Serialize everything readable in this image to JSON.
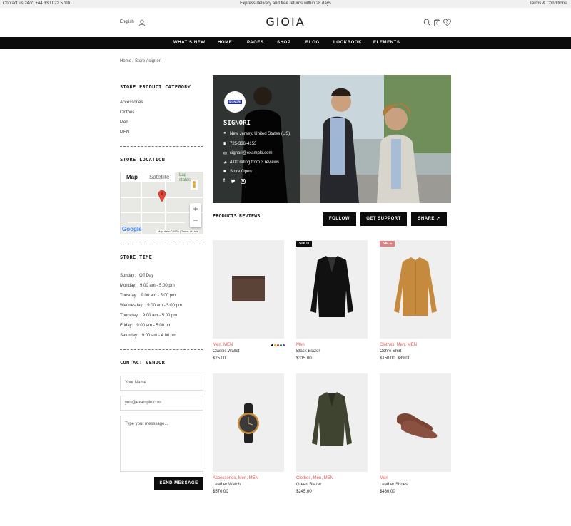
{
  "topbar": {
    "contact": "Contact us 24/7: +44 330 022 5700",
    "promo": "Express delivery and free returns within 28 days",
    "terms": "Terms & Conditions"
  },
  "header": {
    "language": "English",
    "logo": "GIOIA",
    "cart_count": "0",
    "wishlist_count": "0"
  },
  "nav": [
    "WHAT'S NEW",
    "HOME",
    "PAGES",
    "SHOP",
    "BLOG",
    "LOOKBOOK",
    "ELEMENTS"
  ],
  "breadcrumb": "Home / Store / signori",
  "sidebar": {
    "category_title": "STORE PRODUCT CATEGORY",
    "categories": [
      "Accessories",
      "Clothes",
      "Men",
      "MEN"
    ],
    "location_title": "STORE LOCATION",
    "map": {
      "tab_map": "Map",
      "tab_satellite": "Satellite",
      "label_lag": "Lag",
      "label_states": "states",
      "zoom_in": "+",
      "zoom_out": "−",
      "google": "Google",
      "map_data": "Map data ©2020",
      "terms": "Terms of Use"
    },
    "time_title": "STORE TIME",
    "hours": [
      {
        "day": "Sunday:",
        "time": "Off Day"
      },
      {
        "day": "Monday:",
        "time": "9:00 am - 5:00 pm"
      },
      {
        "day": "Tuesday:",
        "time": "9:00 am - 5:00 pm"
      },
      {
        "day": "Wednesday:",
        "time": "9:00 am - 5:00 pm"
      },
      {
        "day": "Thursday:",
        "time": "9:00 am - 5:00 pm"
      },
      {
        "day": "Friday:",
        "time": "9:00 am - 5:00 pm"
      },
      {
        "day": "Saturday:",
        "time": "9:00 am - 4:00 pm"
      }
    ],
    "contact_title": "CONTACT VENDOR",
    "name_placeholder": "Your Name",
    "email_placeholder": "you@example.com",
    "message_placeholder": "Type your messsage...",
    "send_label": "SEND MESSAGE"
  },
  "store": {
    "logo_text": "SIGNORI",
    "name": "SIGNORI",
    "address": "New Jersey, United States (US)",
    "phone": "725-336-4153",
    "email": "signori@example.com",
    "rating": "4.00 rating from 3 reviews",
    "status": "Store Open"
  },
  "tabs": {
    "products": "PRODUCTS",
    "reviews": "REVIEWS"
  },
  "actions": {
    "follow": "FOLLOW",
    "support": "GET SUPPORT",
    "share": "SHARE"
  },
  "products": [
    {
      "category": "Men, MEN",
      "name": "Classic Wallet",
      "price": "$25.00",
      "old_price": "",
      "badge": "",
      "swatches": [
        "#111111",
        "#e0b020",
        "#c23a3a",
        "#2a8a3a",
        "#6a3ab0"
      ]
    },
    {
      "category": "Men",
      "name": "Black Blazer",
      "price": "$315.00",
      "old_price": "",
      "badge": "SOLD"
    },
    {
      "category": "Clothes, Men, MEN",
      "name": "Ochre Shirt",
      "price": "$89.00",
      "old_price": "$150.00",
      "badge": "SALE"
    },
    {
      "category": "Accessories, Men, MEN",
      "name": "Leather Watch",
      "price": "$570.00",
      "old_price": "",
      "badge": ""
    },
    {
      "category": "Clothes, Men, MEN",
      "name": "Green Blazer",
      "price": "$245.00",
      "old_price": "",
      "badge": ""
    },
    {
      "category": "Men",
      "name": "Leather Shoes",
      "price": "$480.00",
      "old_price": "",
      "badge": ""
    }
  ],
  "colors": {
    "accent": "#e05555",
    "dark": "#0c0c0c",
    "sale_badge": "#e08080"
  }
}
